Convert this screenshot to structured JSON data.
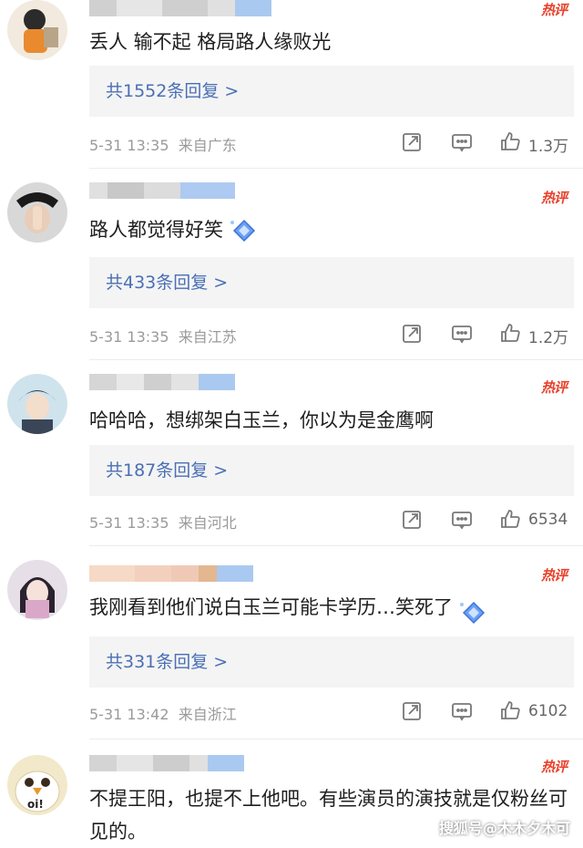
{
  "hot_label": "热评",
  "comments": [
    {
      "text": "丢人 输不起 格局路人缘败光",
      "replies": "共1552条回复 >",
      "time": "5-31 13:35",
      "location": "来自广东",
      "likes": "1.3万",
      "has_sticker": false
    },
    {
      "text": "路人都觉得好笑",
      "replies": "共433条回复 >",
      "time": "5-31 13:35",
      "location": "来自江苏",
      "likes": "1.2万",
      "has_sticker": true
    },
    {
      "text": "哈哈哈，想绑架白玉兰，你以为是金鹰啊",
      "replies": "共187条回复 >",
      "time": "5-31 13:35",
      "location": "来自河北",
      "likes": "6534",
      "has_sticker": false
    },
    {
      "text": "我刚看到他们说白玉兰可能卡学历…笑死了",
      "replies": "共331条回复 >",
      "time": "5-31 13:42",
      "location": "来自浙江",
      "likes": "6102",
      "has_sticker": true
    },
    {
      "text": "不提王阳，也提不上他吧。有些演员的演技就是仅粉丝可见的。",
      "replies": "",
      "time": "",
      "location": "",
      "likes": "",
      "has_sticker": false
    }
  ],
  "watermark": "搜狐号@木木夕木可",
  "icons": {
    "share": "share-icon",
    "comment": "comment-icon",
    "like": "like-icon"
  },
  "colors": {
    "hot": "#e8412b",
    "reply_link": "#4a6fb5",
    "meta": "#9a9a9a"
  }
}
